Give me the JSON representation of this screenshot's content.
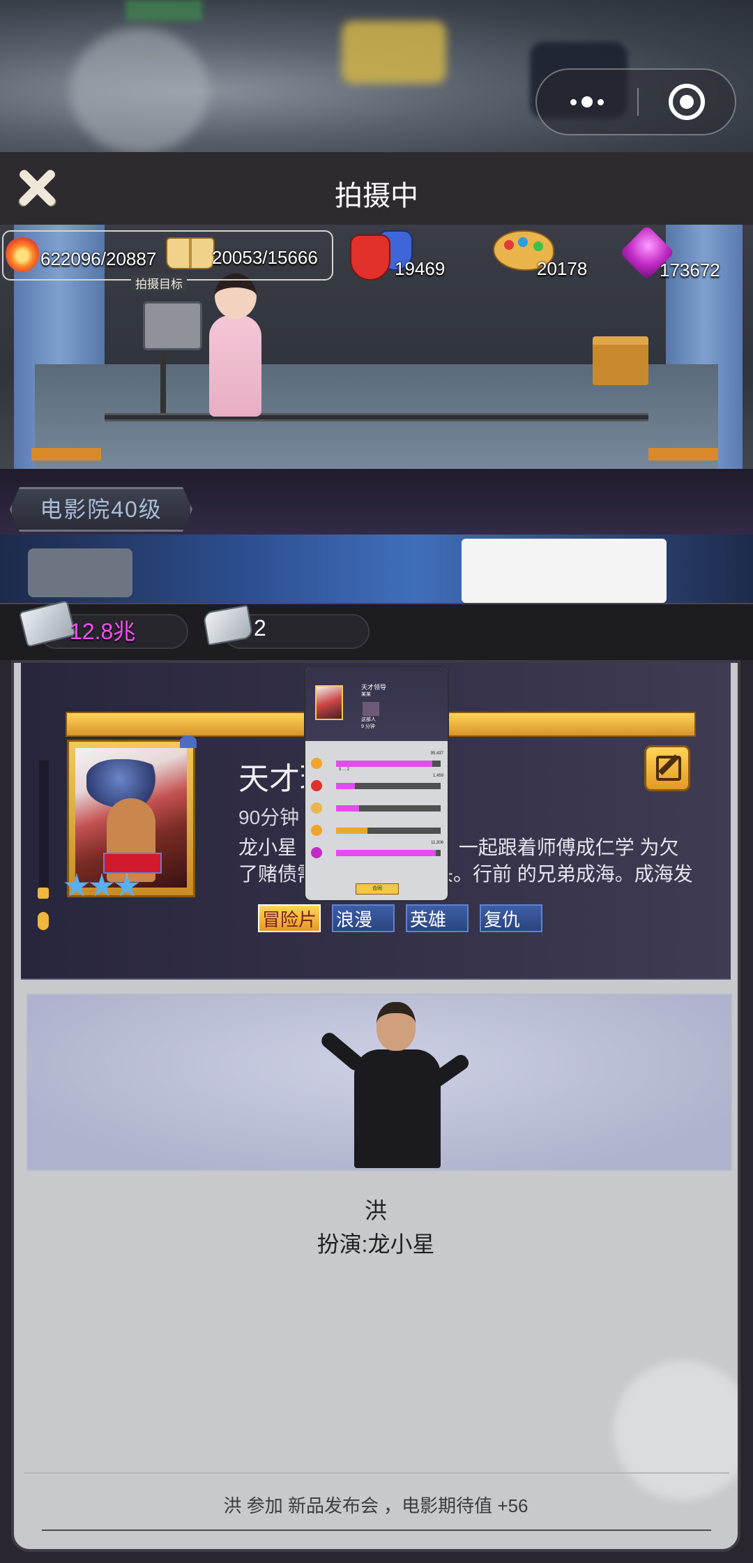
{
  "header": {
    "title": "拍摄中"
  },
  "stats": {
    "progress": "622096/20887",
    "goal_label": "拍摄目标",
    "book": "20053/15666",
    "masks": "19469",
    "palette": "20178",
    "gem": "173672"
  },
  "cinema": {
    "level": "电影院40级"
  },
  "resources": {
    "money": "12.8兆",
    "scripts": "2"
  },
  "film": {
    "title": "天才琼",
    "duration": "90分钟",
    "description": "龙小星（           细细（女主角）一起跟着师傅成仁学           为欠了赌债需要去外地避风头。行前           的兄弟成海。成海发现龙小",
    "rating": 3,
    "genres": [
      "冒险片",
      "浪漫",
      "英雄",
      "复仇"
    ]
  },
  "mini_popup": {
    "title": "天才领导",
    "sub1": "某某",
    "sub2": "这部人",
    "sub3": "9 分钟",
    "stats": [
      {
        "label": "5 ... 2",
        "value": "95,437",
        "fill": 0.92,
        "color": "#e14de8"
      },
      {
        "label": "",
        "value": "1,459",
        "fill": 0.18,
        "color": "#e14de8"
      },
      {
        "label": "",
        "value": "",
        "fill": 0.22,
        "color": "#e14de8"
      },
      {
        "label": "",
        "value": "",
        "fill": 0.3,
        "color": "#f0a52a"
      },
      {
        "label": "",
        "value": "11,306",
        "fill": 0.95,
        "color": "#e14de8"
      }
    ],
    "button": "合同"
  },
  "character": {
    "name": "洪",
    "role": "扮演:龙小星"
  },
  "footer": {
    "message": "洪 参加 新品发布会 ，电影期待值 +56"
  }
}
